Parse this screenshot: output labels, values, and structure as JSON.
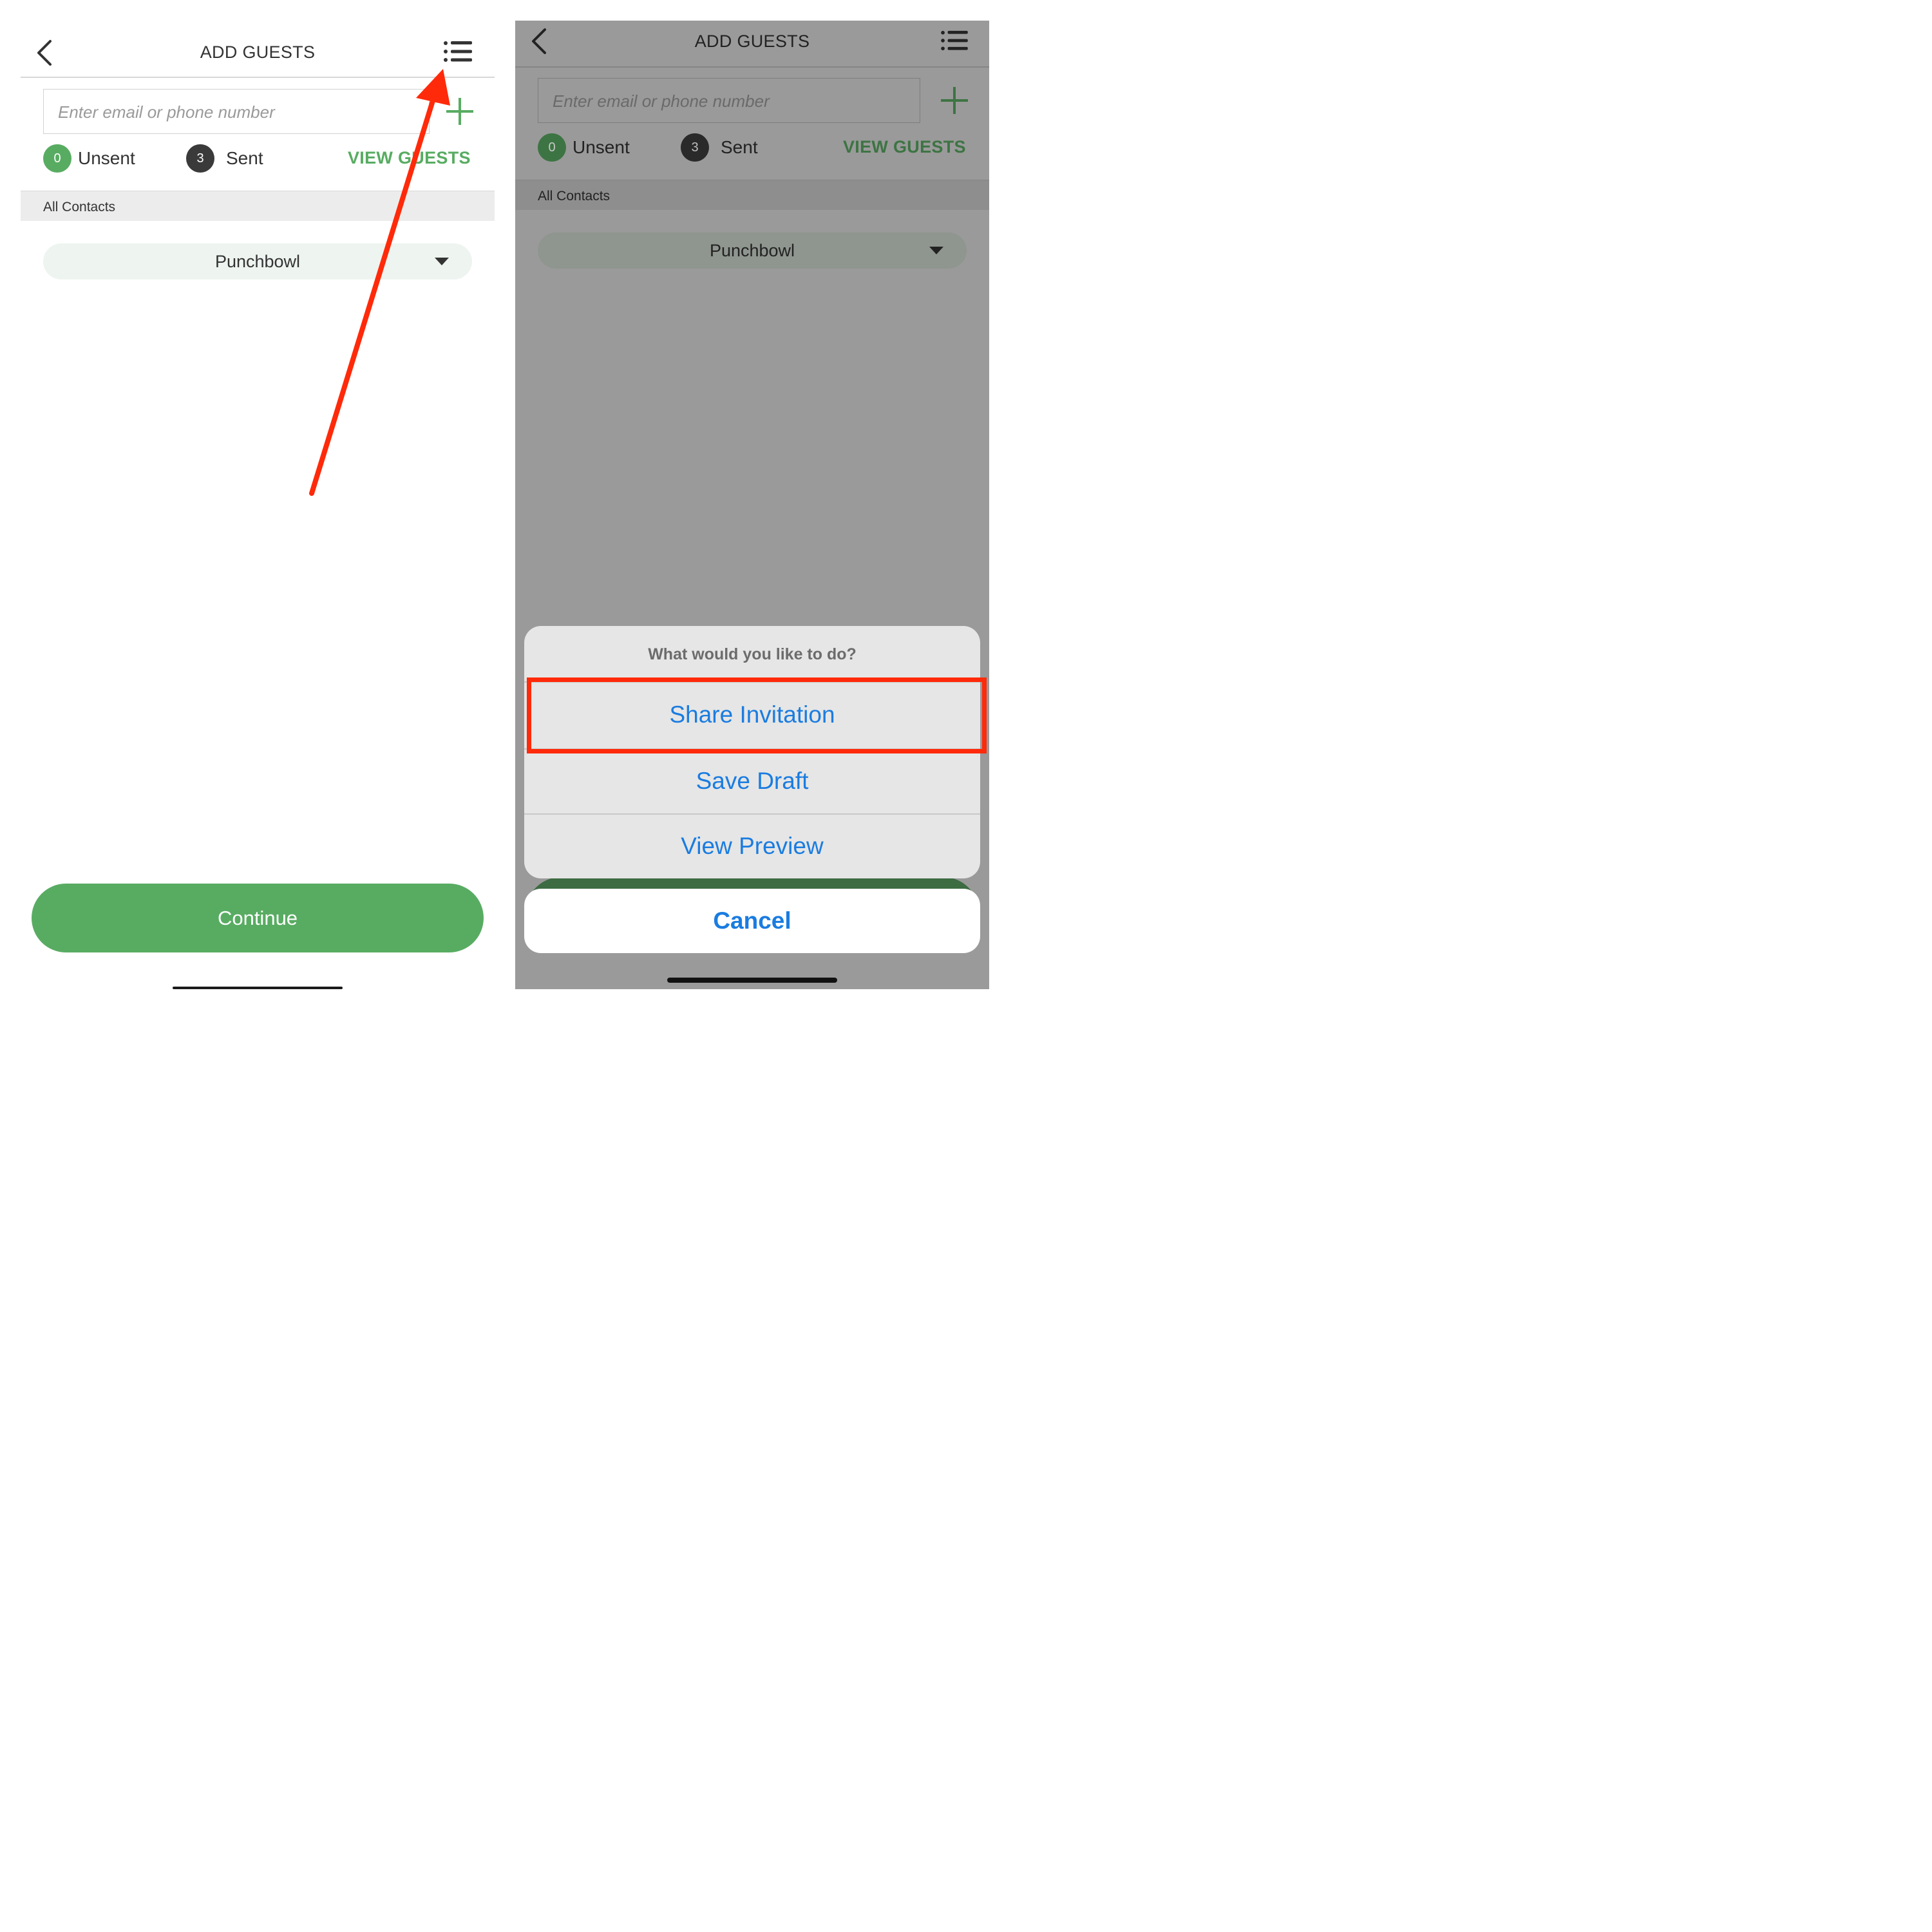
{
  "left": {
    "header": {
      "title": "ADD GUESTS",
      "back_icon": "chevron-left-icon",
      "menu_icon": "list-menu-icon"
    },
    "input": {
      "placeholder": "Enter email or phone number"
    },
    "add_icon": "plus-icon",
    "counts": {
      "unsent": {
        "count": "0",
        "label": "Unsent"
      },
      "sent": {
        "count": "3",
        "label": "Sent"
      }
    },
    "view_guests": "VIEW GUESTS",
    "section": "All Contacts",
    "dropdown": {
      "value": "Punchbowl"
    },
    "continue": "Continue"
  },
  "right": {
    "header": {
      "title": "ADD GUESTS",
      "back_icon": "chevron-left-icon",
      "menu_icon": "list-menu-icon"
    },
    "input": {
      "placeholder": "Enter email or phone number"
    },
    "add_icon": "plus-icon",
    "counts": {
      "unsent": {
        "count": "0",
        "label": "Unsent"
      },
      "sent": {
        "count": "3",
        "label": "Sent"
      }
    },
    "view_guests": "VIEW GUESTS",
    "section": "All Contacts",
    "dropdown": {
      "value": "Punchbowl"
    },
    "action_sheet": {
      "title": "What would you like to do?",
      "options": [
        "Share Invitation",
        "Save Draft",
        "View Preview"
      ],
      "highlighted": "Share Invitation",
      "cancel": "Cancel"
    }
  },
  "colors": {
    "brand_green": "#58ac62",
    "dark_badge": "#3a3a3a",
    "ios_blue": "#1a7ce0",
    "annotation_red": "#ff2a0a"
  }
}
